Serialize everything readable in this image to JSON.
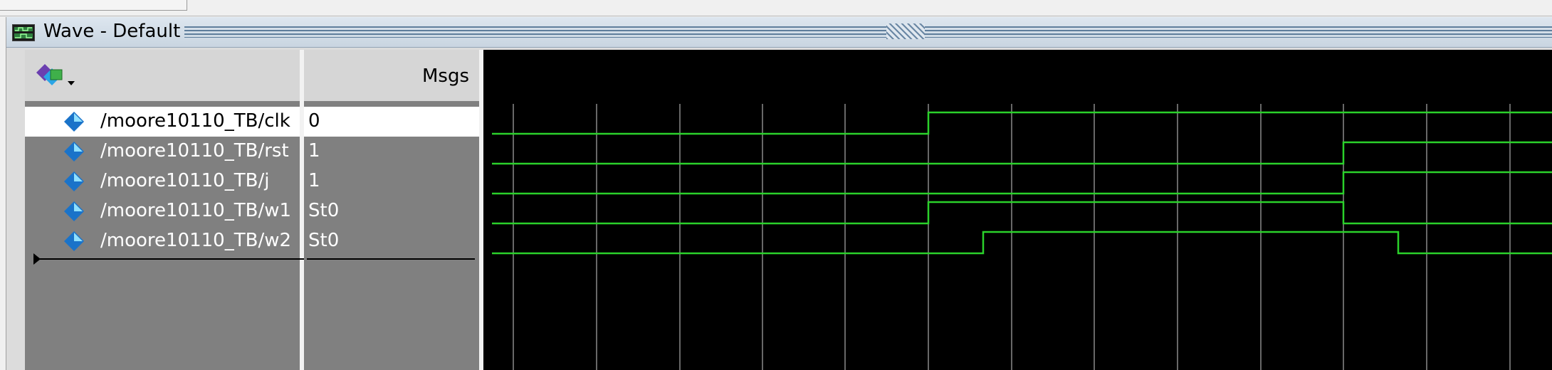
{
  "window": {
    "title": "Wave - Default"
  },
  "header": {
    "msgs_label": "Msgs"
  },
  "signals": [
    {
      "name": "/moore10110_TB/clk",
      "value": "0",
      "selected": true
    },
    {
      "name": "/moore10110_TB/rst",
      "value": "1",
      "selected": false
    },
    {
      "name": "/moore10110_TB/j",
      "value": "1",
      "selected": false
    },
    {
      "name": "/moore10110_TB/w1",
      "value": "St0",
      "selected": false
    },
    {
      "name": "/moore10110_TB/w2",
      "value": "St0",
      "selected": false
    }
  ],
  "colors": {
    "wave": "#2bd12b",
    "grid": "#8a8a8a",
    "diamond_light": "#8fe0ff",
    "diamond_dark": "#1a73c9"
  },
  "icons": {
    "title": "wave-window-icon",
    "toolbar": "add-signal-dropdown-icon",
    "signal": "signal-diamond-icon"
  }
}
